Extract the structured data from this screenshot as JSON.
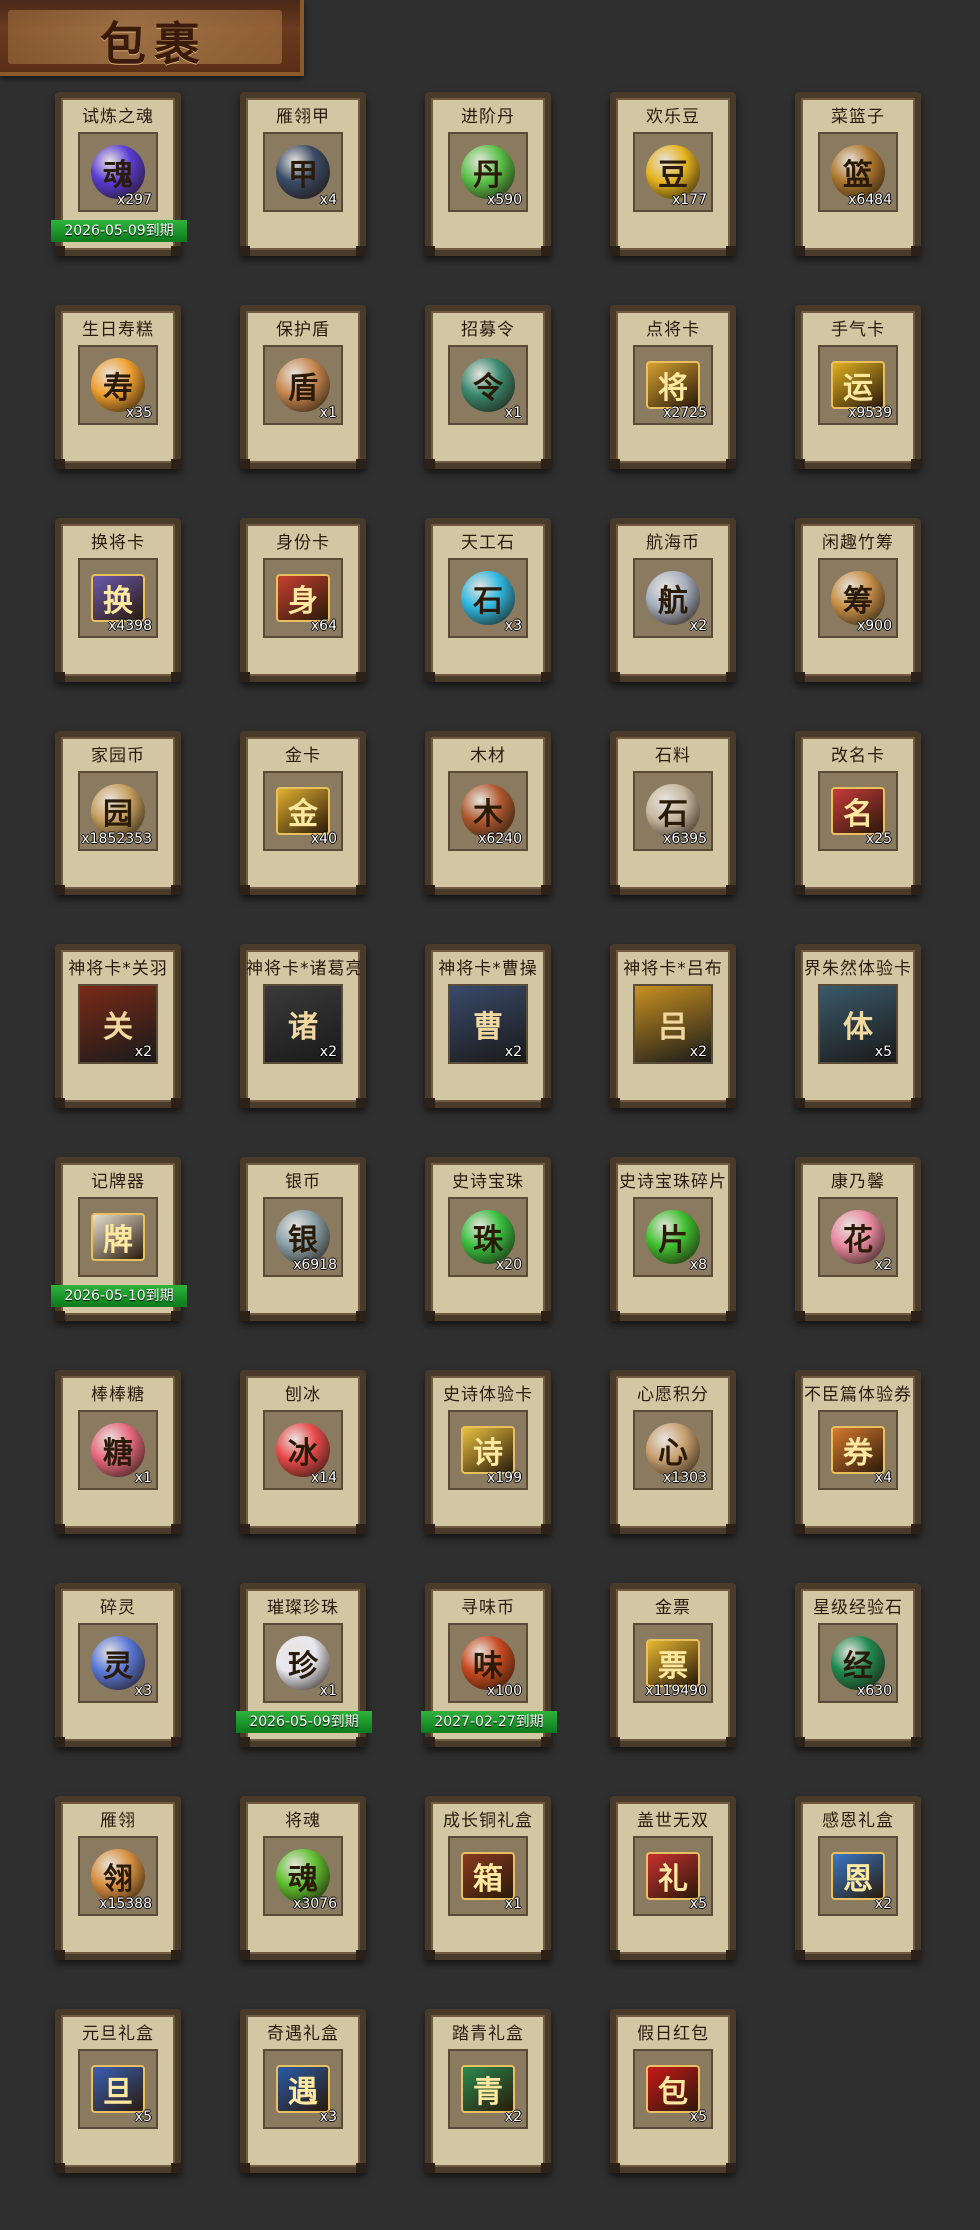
{
  "header": {
    "title": "包裹"
  },
  "items": [
    {
      "name": "试炼之魂",
      "count": "x297",
      "expiry": "2026-05-09到期",
      "icon": "purple-dragon-orb-icon",
      "color": "#5a3cd6",
      "glyph": "魂"
    },
    {
      "name": "雁翎甲",
      "count": "x4",
      "expiry": "",
      "icon": "armor-icon",
      "color": "#3a4a66",
      "glyph": "甲"
    },
    {
      "name": "进阶丹",
      "count": "x590",
      "expiry": "",
      "icon": "green-pill-icon",
      "color": "#5cc24a",
      "glyph": "丹"
    },
    {
      "name": "欢乐豆",
      "count": "x177",
      "expiry": "",
      "icon": "gold-beans-icon",
      "color": "#e6b420",
      "glyph": "豆"
    },
    {
      "name": "菜篮子",
      "count": "x6484",
      "expiry": "",
      "icon": "vegetable-basket-icon",
      "color": "#b07a30",
      "glyph": "篮"
    },
    {
      "name": "生日寿糕",
      "count": "x35",
      "expiry": "",
      "icon": "birthday-cake-icon",
      "color": "#f0a030",
      "glyph": "寿"
    },
    {
      "name": "保护盾",
      "count": "x1",
      "expiry": "",
      "icon": "shield-icon",
      "color": "#c88850",
      "glyph": "盾"
    },
    {
      "name": "招募令",
      "count": "x1",
      "expiry": "",
      "icon": "recruit-token-icon",
      "color": "#3a8a70",
      "glyph": "令"
    },
    {
      "name": "点将卡",
      "count": "x2725",
      "expiry": "",
      "icon": "general-card-icon",
      "color": "#d4a030",
      "glyph": "将"
    },
    {
      "name": "手气卡",
      "count": "x9539",
      "expiry": "",
      "icon": "luck-card-icon",
      "color": "#e0b020",
      "glyph": "运"
    },
    {
      "name": "换将卡",
      "count": "x4398",
      "expiry": "",
      "icon": "swap-card-icon",
      "color": "#6a5ab0",
      "glyph": "换"
    },
    {
      "name": "身份卡",
      "count": "x64",
      "expiry": "",
      "icon": "opera-mask-card-icon",
      "color": "#c84030",
      "glyph": "身"
    },
    {
      "name": "天工石",
      "count": "x3",
      "expiry": "",
      "icon": "blue-crystal-icon",
      "color": "#30b8e0",
      "glyph": "石"
    },
    {
      "name": "航海币",
      "count": "x2",
      "expiry": "",
      "icon": "silver-coin-icon",
      "color": "#a8b0c0",
      "glyph": "航"
    },
    {
      "name": "闲趣竹筹",
      "count": "x900",
      "expiry": "",
      "icon": "bamboo-token-icon",
      "color": "#c89048",
      "glyph": "筹"
    },
    {
      "name": "家园币",
      "count": "x1852353",
      "expiry": "",
      "icon": "home-coin-icon",
      "color": "#c8a060",
      "glyph": "园"
    },
    {
      "name": "金卡",
      "count": "x40",
      "expiry": "",
      "icon": "gold-card-icon",
      "color": "#e0b030",
      "glyph": "金"
    },
    {
      "name": "木材",
      "count": "x6240",
      "expiry": "",
      "icon": "timber-icon",
      "color": "#b05a30",
      "glyph": "木"
    },
    {
      "name": "石料",
      "count": "x6395",
      "expiry": "",
      "icon": "stone-icon",
      "color": "#c8b8a0",
      "glyph": "石"
    },
    {
      "name": "改名卡",
      "count": "x25",
      "expiry": "",
      "icon": "rename-card-icon",
      "color": "#c83a3a",
      "glyph": "名"
    },
    {
      "name": "神将卡*关羽",
      "count": "x2",
      "expiry": "",
      "icon": "guan-yu-portrait-icon",
      "color": "#7a2a18",
      "glyph": "关"
    },
    {
      "name": "神将卡*诸葛亮",
      "count": "x2",
      "expiry": "",
      "icon": "zhuge-liang-portrait-icon",
      "color": "#3a3a3a",
      "glyph": "诸"
    },
    {
      "name": "神将卡*曹操",
      "count": "x2",
      "expiry": "",
      "icon": "cao-cao-portrait-icon",
      "color": "#3a4a6a",
      "glyph": "曹"
    },
    {
      "name": "神将卡*吕布",
      "count": "x2",
      "expiry": "",
      "icon": "lu-bu-portrait-icon",
      "color": "#c89020",
      "glyph": "吕"
    },
    {
      "name": "界朱然体验卡",
      "count": "x5",
      "expiry": "",
      "icon": "zhu-ran-portrait-icon",
      "color": "#3a5a6a",
      "glyph": "体"
    },
    {
      "name": "记牌器",
      "count": "",
      "expiry": "2026-05-10到期",
      "icon": "playing-cards-icon",
      "color": "#e8e0d0",
      "glyph": "牌"
    },
    {
      "name": "银币",
      "count": "x6918",
      "expiry": "",
      "icon": "silver-coins-icon",
      "color": "#8aa0a8",
      "glyph": "银"
    },
    {
      "name": "史诗宝珠",
      "count": "x20",
      "expiry": "",
      "icon": "green-orb-icon",
      "color": "#38c040",
      "glyph": "珠"
    },
    {
      "name": "史诗宝珠碎片",
      "count": "x8",
      "expiry": "",
      "icon": "green-shard-icon",
      "color": "#40c030",
      "glyph": "片"
    },
    {
      "name": "康乃馨",
      "count": "x2",
      "expiry": "",
      "icon": "carnation-bouquet-icon",
      "color": "#e88aa0",
      "glyph": "花"
    },
    {
      "name": "棒棒糖",
      "count": "x1",
      "expiry": "",
      "icon": "lollipop-icon",
      "color": "#e86a80",
      "glyph": "糖"
    },
    {
      "name": "刨冰",
      "count": "x14",
      "expiry": "",
      "icon": "shaved-ice-icon",
      "color": "#e84a4a",
      "glyph": "冰"
    },
    {
      "name": "史诗体验卡",
      "count": "x199",
      "expiry": "",
      "icon": "epic-trial-card-icon",
      "color": "#e8c040",
      "glyph": "诗"
    },
    {
      "name": "心愿积分",
      "count": "x1303",
      "expiry": "",
      "icon": "heart-coin-icon",
      "color": "#c8a070",
      "glyph": "心"
    },
    {
      "name": "不臣篇体验券",
      "count": "x4",
      "expiry": "",
      "icon": "trial-ticket-icon",
      "color": "#d87a30",
      "glyph": "券"
    },
    {
      "name": "碎灵",
      "count": "x3",
      "expiry": "",
      "icon": "blue-spirit-shard-icon",
      "color": "#5a78d8",
      "glyph": "灵"
    },
    {
      "name": "璀璨珍珠",
      "count": "x1",
      "expiry": "2026-05-09到期",
      "icon": "pearl-icon",
      "color": "#e8e8f0",
      "glyph": "珍"
    },
    {
      "name": "寻味币",
      "count": "x100",
      "expiry": "2027-02-27到期",
      "icon": "flavor-coin-icon",
      "color": "#c84a20",
      "glyph": "味"
    },
    {
      "name": "金票",
      "count": "x119490",
      "expiry": "",
      "icon": "gold-ticket-icon",
      "color": "#e8b830",
      "glyph": "票"
    },
    {
      "name": "星级经验石",
      "count": "x630",
      "expiry": "",
      "icon": "green-exp-stone-icon",
      "color": "#208a50",
      "glyph": "经"
    },
    {
      "name": "雁翎",
      "count": "x15388",
      "expiry": "",
      "icon": "feather-icon",
      "color": "#d89040",
      "glyph": "翎"
    },
    {
      "name": "将魂",
      "count": "x3076",
      "expiry": "",
      "icon": "green-soul-icon",
      "color": "#60c030",
      "glyph": "魂"
    },
    {
      "name": "成长铜礼盒",
      "count": "x1",
      "expiry": "",
      "icon": "copper-chest-icon",
      "color": "#8a3a20",
      "glyph": "箱"
    },
    {
      "name": "盖世无双",
      "count": "x5",
      "expiry": "",
      "icon": "red-gift-box-icon",
      "color": "#c83030",
      "glyph": "礼"
    },
    {
      "name": "感恩礼盒",
      "count": "x2",
      "expiry": "",
      "icon": "blue-gift-box-icon",
      "color": "#3a78c8",
      "glyph": "恩"
    },
    {
      "name": "元旦礼盒",
      "count": "x5",
      "expiry": "",
      "icon": "new-year-gift-box-icon",
      "color": "#3a60b8",
      "glyph": "旦"
    },
    {
      "name": "奇遇礼盒",
      "count": "x3",
      "expiry": "",
      "icon": "adventure-gift-box-icon",
      "color": "#2a5aa8",
      "glyph": "遇"
    },
    {
      "name": "踏青礼盒",
      "count": "x2",
      "expiry": "",
      "icon": "spring-gift-box-icon",
      "color": "#2a8a50",
      "glyph": "青"
    },
    {
      "name": "假日红包",
      "count": "x5",
      "expiry": "",
      "icon": "red-envelope-icon",
      "color": "#c81818",
      "glyph": "包"
    }
  ]
}
